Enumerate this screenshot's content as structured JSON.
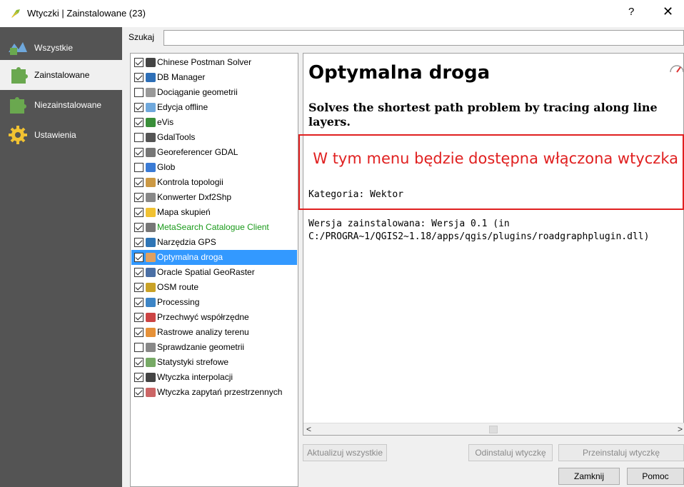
{
  "window": {
    "title": "Wtyczki | Zainstalowane (23)",
    "help_glyph": "?",
    "close_glyph": "✕"
  },
  "sidebar": {
    "items": [
      {
        "label": "Wszystkie",
        "icon": "all-plugins-icon",
        "selected": false
      },
      {
        "label": "Zainstalowane",
        "icon": "installed-plugins-icon",
        "selected": true
      },
      {
        "label": "Niezainstalowane",
        "icon": "not-installed-plugins-icon",
        "selected": false
      },
      {
        "label": "Ustawienia",
        "icon": "settings-gear-icon",
        "selected": false
      }
    ]
  },
  "search": {
    "label": "Szukaj",
    "value": ""
  },
  "plugins": [
    {
      "name": "Chinese Postman Solver",
      "checked": true,
      "icon": "postman-icon"
    },
    {
      "name": "DB Manager",
      "checked": true,
      "icon": "database-icon"
    },
    {
      "name": "Dociąganie geometrii",
      "checked": false,
      "icon": "snap-geometry-icon"
    },
    {
      "name": "Edycja offline",
      "checked": true,
      "icon": "offline-edit-icon"
    },
    {
      "name": "eVis",
      "checked": true,
      "icon": "evis-icon"
    },
    {
      "name": "GdalTools",
      "checked": false,
      "icon": "gdal-icon"
    },
    {
      "name": "Georeferencer GDAL",
      "checked": true,
      "icon": "georeferencer-icon"
    },
    {
      "name": "Glob",
      "checked": false,
      "icon": "globe-icon"
    },
    {
      "name": "Kontrola topologii",
      "checked": true,
      "icon": "topology-icon"
    },
    {
      "name": "Konwerter Dxf2Shp",
      "checked": true,
      "icon": "dxf-converter-icon"
    },
    {
      "name": "Mapa skupień",
      "checked": true,
      "icon": "heatmap-icon"
    },
    {
      "name": "MetaSearch Catalogue Client",
      "checked": true,
      "icon": "metasearch-icon",
      "highlight": "#1a9a1a"
    },
    {
      "name": "Narzędzia GPS",
      "checked": true,
      "icon": "gps-icon"
    },
    {
      "name": "Optymalna droga",
      "checked": true,
      "icon": "road-graph-icon",
      "selected": true
    },
    {
      "name": "Oracle Spatial GeoRaster",
      "checked": true,
      "icon": "oracle-icon"
    },
    {
      "name": "OSM route",
      "checked": true,
      "icon": "osm-route-icon"
    },
    {
      "name": "Processing",
      "checked": true,
      "icon": "processing-gear-icon"
    },
    {
      "name": "Przechwyć współrzędne",
      "checked": true,
      "icon": "coordinate-capture-icon"
    },
    {
      "name": "Rastrowe analizy terenu",
      "checked": true,
      "icon": "terrain-icon"
    },
    {
      "name": "Sprawdzanie geometrii",
      "checked": false,
      "icon": "geometry-checker-icon"
    },
    {
      "name": "Statystyki strefowe",
      "checked": true,
      "icon": "zonal-stats-icon"
    },
    {
      "name": "Wtyczka interpolacji",
      "checked": true,
      "icon": "interpolation-icon"
    },
    {
      "name": "Wtyczka zapytań przestrzennych",
      "checked": true,
      "icon": "spatial-query-icon"
    }
  ],
  "detail": {
    "title": "Optymalna droga",
    "description": "Solves the shortest path problem by tracing along line layers.",
    "annotation": "W tym menu będzie dostępna włączona wtyczka",
    "category": "Kategoria: Wektor",
    "version_line1": "Wersja zainstalowana: Wersja 0.1 (in",
    "version_line2": "C:/PROGRA~1/QGIS2~1.18/apps/qgis/plugins/roadgraphplugin.dll)"
  },
  "buttons": {
    "update_all": "Aktualizuj wszystkie",
    "uninstall": "Odinstaluj wtyczkę",
    "reinstall": "Przeinstaluj wtyczkę",
    "close": "Zamknij",
    "help": "Pomoc"
  },
  "colors": {
    "sidebar_bg": "#545454",
    "selection": "#3399ff",
    "annotation_red": "#e02020"
  }
}
